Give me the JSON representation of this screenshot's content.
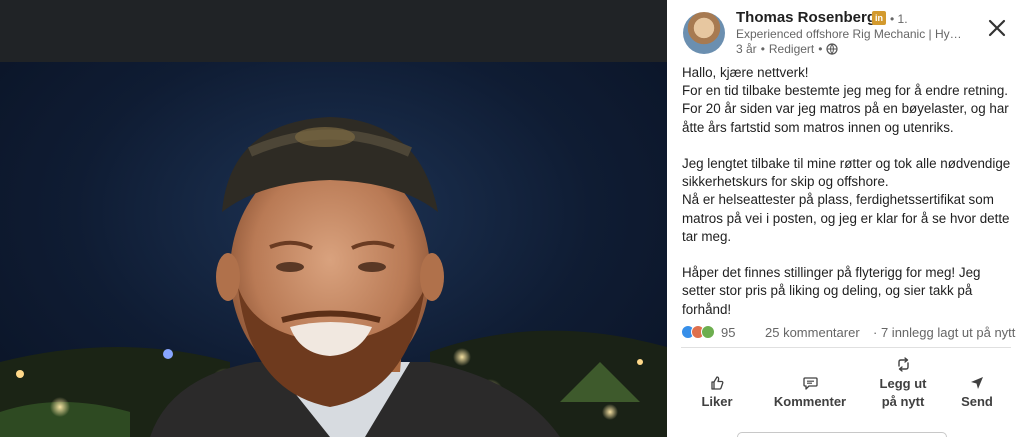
{
  "post": {
    "author": {
      "name": "Thomas Rosenberg",
      "badge": "in",
      "degree": "• 1.",
      "headline": "Experienced offshore Rig Mechanic | Hydr...",
      "age": "3 år",
      "edited": "Redigert",
      "visibility_icon": "globe-icon"
    },
    "body": [
      "Hallo, kjære nettverk!",
      "For en tid tilbake bestemte jeg meg for å endre retning.",
      "For 20 år siden var jeg matros på en bøyelaster, og har åtte års fartstid som matros innen og utenriks.",
      "",
      "Jeg lengtet tilbake til mine røtter og tok alle nødvendige sikkerhetskurs for skip og offshore.",
      "Nå er helseattester på plass, ferdighetssertifikat som matros på vei i posten, og jeg er klar for å se hvor dette tar meg.",
      "",
      "Håper det finnes stillinger på flyterigg for meg! Jeg setter stor pris på liking og deling, og sier takk på forhånd!"
    ],
    "social": {
      "reaction_count": "95",
      "comments": "25 kommentarer",
      "separator": "·",
      "reposts": "7 innlegg lagt ut på nytt",
      "reaction_colors": [
        "#378fe9",
        "#df704d",
        "#6dae4f"
      ]
    },
    "actions": {
      "like": "Liker",
      "comment": "Kommenter",
      "repost": "Legg ut på nytt",
      "send": "Send"
    }
  },
  "colors": {
    "panel_bg": "#ffffff",
    "photo_bg": "#0f1c33",
    "text_primary": "#1f1f1f",
    "text_secondary": "#666666",
    "badge": "#d39a2e"
  }
}
